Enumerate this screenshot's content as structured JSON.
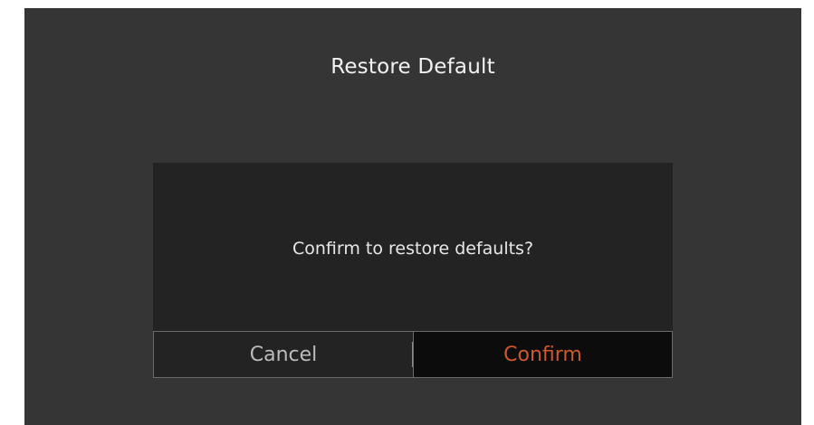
{
  "header": {
    "title": "Restore Default"
  },
  "dialog": {
    "message": "Confirm to restore defaults?",
    "cancel_label": "Cancel",
    "confirm_label": "Confirm"
  },
  "colors": {
    "background": "#353535",
    "dialog_background": "#232323",
    "confirm_button_background": "#0c0c0c",
    "confirm_text": "#d0562f",
    "cancel_text": "#bcbcbc",
    "title_text": "#f2f2f2"
  }
}
